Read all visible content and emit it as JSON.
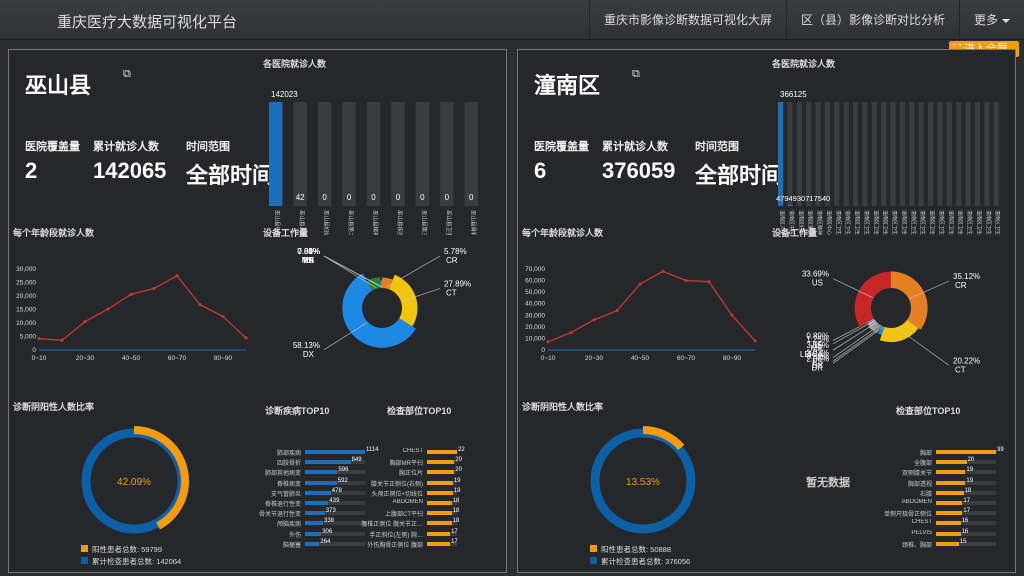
{
  "nav": {
    "brand": "重庆医疗大数据可视化平台",
    "links": [
      "重庆市影像诊断数据可视化大屏",
      "区（县）影像诊断对比分析"
    ],
    "more": "更多"
  },
  "fullscreen": "进入全屏",
  "colors": {
    "accent": "#f39c12",
    "blue": "#1e88e5",
    "line": "#c0392b",
    "darkblue": "#0d5fa6"
  },
  "panels": [
    {
      "region": "巫山县",
      "external_icon": "external-link-icon",
      "stats": [
        {
          "label": "医院覆盖量",
          "value": "2"
        },
        {
          "label": "累计就诊人数",
          "value": "142065"
        },
        {
          "label": "时间范围",
          "value": "全部时间"
        }
      ],
      "hospital_chart": {
        "title": "各医院就诊人数",
        "top_label": "142023",
        "bars": [
          {
            "name": "巫山县中医院",
            "value": 142023
          },
          {
            "name": "巫山县人民医院",
            "value": 42
          },
          {
            "name": "巫山县妇幼保健院",
            "value": 0
          },
          {
            "name": "巫山县第二人民医院",
            "value": 0
          },
          {
            "name": "巫山县精神卫生中心",
            "value": 0
          },
          {
            "name": "巫山县疾控中心",
            "value": 0
          },
          {
            "name": "巫山县第三人民医院",
            "value": 0
          },
          {
            "name": "巫山县卫生院",
            "value": 0
          },
          {
            "name": "巫山县骨科医院",
            "value": 0
          }
        ]
      },
      "age_chart": {
        "title": "每个年龄段就诊人数",
        "type": "line",
        "ylim": [
          0,
          30000
        ],
        "yticks": [
          "30,000",
          "25,000",
          "20,000",
          "15,000",
          "10,000",
          "5,000",
          "0"
        ],
        "xticks": [
          "0~10",
          "20~30",
          "40~50",
          "60~70",
          "80~90"
        ],
        "values": [
          4200,
          3600,
          10500,
          15200,
          20600,
          22800,
          27500,
          16800,
          12400,
          4500
        ]
      },
      "device_chart": {
        "title": "设备工作量",
        "slices": [
          {
            "label": "CR",
            "pct": "5.78%",
            "value": 5.78
          },
          {
            "label": "CT",
            "pct": "27.89%",
            "value": 27.89
          },
          {
            "label": "DX",
            "pct": "58.13%",
            "value": 58.13
          },
          {
            "label": "MR",
            "pct": "7.34%",
            "value": 7.34
          },
          {
            "label": "RF",
            "pct": "0.85%",
            "value": 0.85
          },
          {
            "label": "US",
            "pct": "0%",
            "value": 0
          },
          {
            "label": "XA",
            "pct": "0.01%",
            "value": 0.01
          }
        ]
      },
      "positive_chart": {
        "title": "诊断阴阳性人数比率",
        "center": "42.09%",
        "ratio": 0.4209,
        "legend": [
          {
            "label": "阳性患者总数: 59799"
          },
          {
            "label": "累计检查患者总数: 142064"
          }
        ]
      },
      "disease_top": {
        "title": "诊断疾病TOP10",
        "items": [
          {
            "label": "肺部疾病",
            "value": "1114",
            "ratio": 1.0
          },
          {
            "label": "四肢骨折",
            "value": "849",
            "ratio": 0.76
          },
          {
            "label": "肺部其他病变",
            "value": "596",
            "ratio": 0.54
          },
          {
            "label": "脊椎病变",
            "value": "592",
            "ratio": 0.53
          },
          {
            "label": "支气管肺炎",
            "value": "478",
            "ratio": 0.43
          },
          {
            "label": "脊椎退行性变",
            "value": "439",
            "ratio": 0.39
          },
          {
            "label": "骨关节退行性变",
            "value": "373",
            "ratio": 0.33
          },
          {
            "label": "颅脑疾病",
            "value": "338",
            "ratio": 0.3
          },
          {
            "label": "外伤",
            "value": "306",
            "ratio": 0.27
          },
          {
            "label": "脑梗塞",
            "value": "264",
            "ratio": 0.24
          }
        ]
      },
      "part_top": {
        "title": "检查部位TOP10",
        "items": [
          {
            "label": "CHEST",
            "value": "22",
            "ratio": 1.0
          },
          {
            "label": "胸部MR平扫",
            "value": "20",
            "ratio": 0.91
          },
          {
            "label": "胸正位片",
            "value": "20",
            "ratio": 0.91
          },
          {
            "label": "膝关节正侧位(右侧)",
            "value": "19",
            "ratio": 0.86
          },
          {
            "label": "头颅正侧位+切线位",
            "value": "19",
            "ratio": 0.86
          },
          {
            "label": "ABDOMEN",
            "value": "18",
            "ratio": 0.82
          },
          {
            "label": "上腹部CT平扫",
            "value": "18",
            "ratio": 0.82
          },
          {
            "label": "腰椎正侧位 髋关节正…",
            "value": "18",
            "ratio": 0.82
          },
          {
            "label": "手正斜位(左侧) 腕…",
            "value": "17",
            "ratio": 0.77
          },
          {
            "label": "外伤胸骨正侧位 腹部",
            "value": "17",
            "ratio": 0.77
          }
        ]
      }
    },
    {
      "region": "潼南区",
      "external_icon": "external-link-icon",
      "stats": [
        {
          "label": "医院覆盖量",
          "value": "6"
        },
        {
          "label": "累计就诊人数",
          "value": "376059"
        },
        {
          "label": "时间范围",
          "value": "全部时间"
        }
      ],
      "hospital_chart": {
        "title": "各医院就诊人数",
        "top_label": "366125",
        "low_labels": "4794930717540",
        "bars": [
          {
            "name": "潼南区人民医院",
            "value": 366125
          },
          {
            "name": "潼南区中医院",
            "value": 4794
          },
          {
            "name": "潼南区妇幼保健院",
            "value": 930
          },
          {
            "name": "潼南区第二人民医院",
            "value": 717
          },
          {
            "name": "潼南区精神卫生中心",
            "value": 540
          },
          {
            "name": "潼南区中心卫生院",
            "value": 0
          },
          {
            "name": "潼南区卫生院1",
            "value": 0
          },
          {
            "name": "潼南区卫生院2",
            "value": 0
          },
          {
            "name": "潼南区卫生院3",
            "value": 0
          },
          {
            "name": "潼南区卫生院4",
            "value": 0
          },
          {
            "name": "潼南区卫生院5",
            "value": 0
          },
          {
            "name": "潼南区卫生院6",
            "value": 0
          },
          {
            "name": "潼南区卫生院7",
            "value": 0
          },
          {
            "name": "潼南区卫生院8",
            "value": 0
          },
          {
            "name": "潼南区卫生院9",
            "value": 0
          },
          {
            "name": "潼南区卫生院10",
            "value": 0
          },
          {
            "name": "潼南区卫生院11",
            "value": 0
          },
          {
            "name": "潼南区卫生院12",
            "value": 0
          },
          {
            "name": "潼南区卫生院13",
            "value": 0
          },
          {
            "name": "潼南区卫生院14",
            "value": 0
          },
          {
            "name": "潼南区卫生院15",
            "value": 0
          },
          {
            "name": "潼南区卫生院16",
            "value": 0
          },
          {
            "name": "潼南区卫生院17",
            "value": 0
          },
          {
            "name": "潼南区卫生院18",
            "value": 0
          }
        ]
      },
      "age_chart": {
        "title": "每个年龄段就诊人数",
        "type": "line",
        "ylim": [
          0,
          70000
        ],
        "yticks": [
          "70,000",
          "60,000",
          "50,000",
          "40,000",
          "30,000",
          "20,000",
          "10,000",
          "0"
        ],
        "xticks": [
          "0~10",
          "20~30",
          "40~50",
          "60~70",
          "80~90"
        ],
        "values": [
          7000,
          15000,
          26000,
          34000,
          57000,
          68000,
          60000,
          59000,
          30000,
          8000
        ]
      },
      "device_chart": {
        "title": "设备工作量",
        "slices": [
          {
            "label": "CR",
            "pct": "35.12%",
            "value": 35.12
          },
          {
            "label": "CT",
            "pct": "20.22%",
            "value": 20.22
          },
          {
            "label": "DR",
            "pct": "2.06%",
            "value": 2.06
          },
          {
            "label": "DX",
            "pct": "0.59%",
            "value": 0.59
          },
          {
            "label": "ES",
            "pct": "3.02%",
            "value": 3.02
          },
          {
            "label": "LEICA",
            "pct": "3.16%",
            "value": 3.16
          },
          {
            "label": "MR",
            "pct": "1.25%",
            "value": 1.25
          },
          {
            "label": "RF",
            "pct": "0.89%",
            "value": 0.89
          },
          {
            "label": "US",
            "pct": "33.69%",
            "value": 33.69
          }
        ]
      },
      "positive_chart": {
        "title": "诊断阴阳性人数比率",
        "center": "13.53%",
        "ratio": 0.1353,
        "legend": [
          {
            "label": "阳性患者总数: 50888"
          },
          {
            "label": "累计检查患者总数: 376056"
          }
        ]
      },
      "disease_top": {
        "title": "",
        "nodata": "暂无数据",
        "items": []
      },
      "part_top": {
        "title": "检查部位TOP10",
        "items": [
          {
            "label": "胸部",
            "value": "39",
            "ratio": 1.0
          },
          {
            "label": "全腹部",
            "value": "20",
            "ratio": 0.51
          },
          {
            "label": "双侧膝关节",
            "value": "19",
            "ratio": 0.49
          },
          {
            "label": "胸部透视",
            "value": "19",
            "ratio": 0.49
          },
          {
            "label": "右膝",
            "value": "18",
            "ratio": 0.46
          },
          {
            "label": "ABDOMEN",
            "value": "17",
            "ratio": 0.44
          },
          {
            "label": "单侧尺桡骨正侧位",
            "value": "17",
            "ratio": 0.44
          },
          {
            "label": "CHEST",
            "value": "16",
            "ratio": 0.41
          },
          {
            "label": "PELVIS",
            "value": "16",
            "ratio": 0.41
          },
          {
            "label": "颈椎、胸部",
            "value": "15",
            "ratio": 0.38
          }
        ]
      }
    }
  ]
}
